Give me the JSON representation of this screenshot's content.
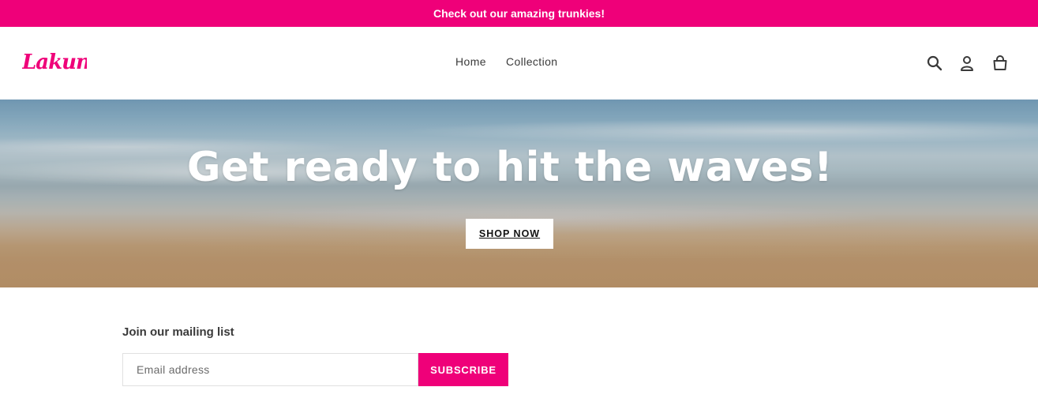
{
  "announcement": {
    "text": "Check out our amazing trunkies!"
  },
  "header": {
    "logo_text": "Lakuna",
    "nav": [
      {
        "label": "Home"
      },
      {
        "label": "Collection"
      }
    ],
    "icons": [
      "search-icon",
      "account-icon",
      "cart-icon"
    ]
  },
  "hero": {
    "title": "Get ready to hit the waves!",
    "button_label": "SHOP NOW"
  },
  "newsletter": {
    "title": "Join our mailing list",
    "email_placeholder": "Email address",
    "email_value": "",
    "subscribe_label": "SUBSCRIBE"
  },
  "colors": {
    "brand_pink": "#ef0079",
    "text": "#3a3a3a",
    "white": "#ffffff"
  }
}
